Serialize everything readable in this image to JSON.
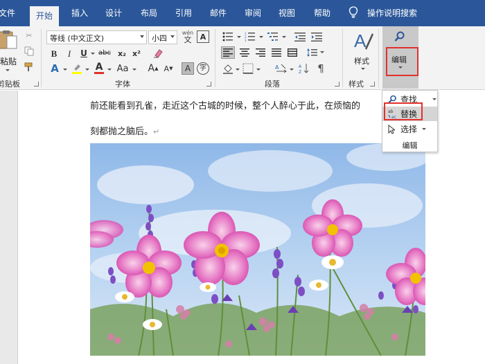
{
  "tabs": [
    {
      "label": "文件",
      "active": false
    },
    {
      "label": "开始",
      "active": true
    },
    {
      "label": "插入",
      "active": false
    },
    {
      "label": "设计",
      "active": false
    },
    {
      "label": "布局",
      "active": false
    },
    {
      "label": "引用",
      "active": false
    },
    {
      "label": "邮件",
      "active": false
    },
    {
      "label": "审阅",
      "active": false
    },
    {
      "label": "视图",
      "active": false
    },
    {
      "label": "帮助",
      "active": false
    }
  ],
  "tell_me": {
    "label": "操作说明搜索",
    "icon": "lightbulb-icon"
  },
  "ribbon": {
    "clipboard": {
      "paste_label": "粘贴",
      "group_label": "剪贴板"
    },
    "font": {
      "font_name": "等线 (中文正文)",
      "font_size": "小四",
      "group_label": "字体",
      "format_buttons": [
        "B",
        "I",
        "U",
        "abc",
        "x₂",
        "x²"
      ],
      "grow_shrink": [
        "A",
        "A"
      ],
      "case_label": "Aa",
      "wen_label": "wén",
      "highlight_color": "#ffff00",
      "font_color": "#e0312c"
    },
    "paragraph": {
      "group_label": "段落"
    },
    "styles": {
      "label": "样式",
      "group_label": "样式"
    },
    "editing": {
      "label": "编辑",
      "highlighted": true
    }
  },
  "dropdown": {
    "items": [
      {
        "label": "查找",
        "icon": "search-icon",
        "highlighted": false,
        "has_arrow": true
      },
      {
        "label": "替换",
        "icon": "replace-icon",
        "highlighted": true,
        "has_arrow": false
      },
      {
        "label": "选择",
        "icon": "cursor-icon",
        "highlighted": false,
        "has_arrow": true
      }
    ],
    "group_label": "编辑"
  },
  "document": {
    "paragraphs": [
      "前还能看到孔雀，走近这个古城的时候，整个人醉心于此，在烦恼的",
      "刻都抛之脑后。"
    ],
    "paragraph_mark": "↵",
    "image": {
      "subject": "pink cosmos flowers and purple lavender against a blue sky with clouds"
    }
  },
  "colors": {
    "tab_bar": "#2b579a",
    "ribbon_bg": "#f3f3f3",
    "highlight_box": "#e0312c"
  }
}
